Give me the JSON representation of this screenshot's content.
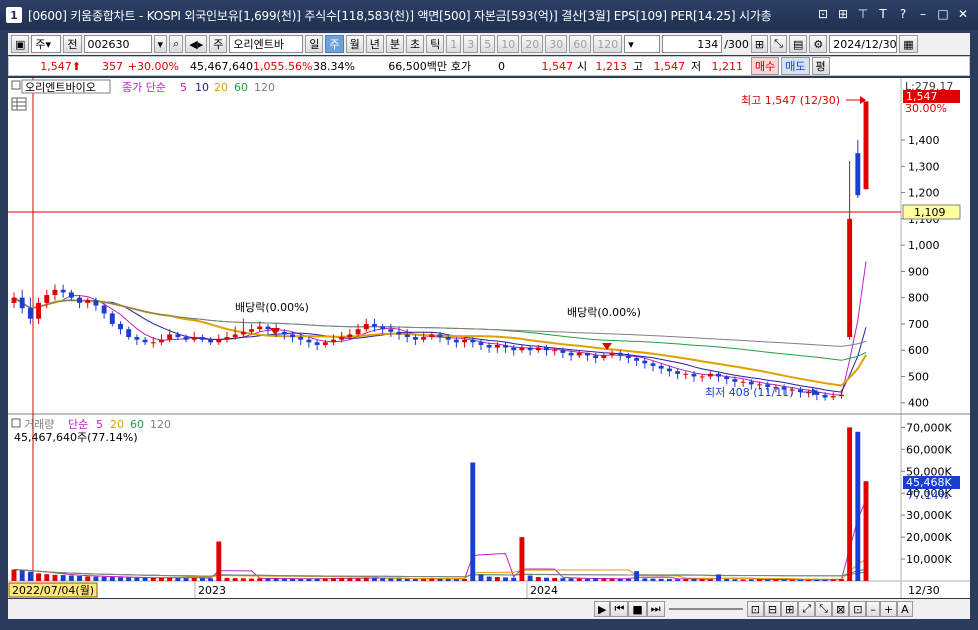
{
  "window": {
    "number": "1",
    "title": "[0600] 키움종합차트 - KOSPI 외국인보유[1,699(천)] 주식수[118,583(천)] 액면[500] 자본금[593(억)] 결산[3월] EPS[109] PER[14.25] 시가총"
  },
  "toolbar": {
    "period_select": "주",
    "prev_label": "전",
    "code": "002630",
    "stock_name": "오리엔트바",
    "periods": [
      "일",
      "주",
      "월",
      "년",
      "분",
      "초",
      "틱"
    ],
    "selected_period": "주",
    "intervals": [
      "1",
      "3",
      "5",
      "10",
      "20",
      "30",
      "60",
      "120"
    ],
    "count": "134",
    "count_total": "/300",
    "date": "2024/12/30"
  },
  "info": {
    "price": "1,547",
    "change": "357",
    "change_pct": "+30.00%",
    "volume": "45,467,640",
    "volume_ratio": "1,055.56%",
    "turnover": "38.34%",
    "amount": "66,500백만",
    "quote_label": "호가",
    "quote_value": "0",
    "quote_price": "1,547",
    "open_label": "시",
    "open": "1,213",
    "high_label": "고",
    "high": "1,547",
    "low_label": "저",
    "low": "1,211",
    "buy_btn": "매수",
    "sell_btn": "매도",
    "eval_btn": "평"
  },
  "price_panel": {
    "name": "오리엔트바이오",
    "legend_main": "종가 단순",
    "ma": [
      "5",
      "10",
      "20",
      "60",
      "120"
    ],
    "high_annotation": "최고 1,547 (12/30)",
    "low_annotation": "최저 408 (11/11)",
    "dividend1": "배당락(0.00%)",
    "dividend2": "배당락(0.00%)",
    "current_price_tag": "1,547",
    "line_tag": "1,109",
    "axis_top_text": "L:279.17",
    "axis_pct": "30.00%",
    "y_ticks": [
      "1,400",
      "1,300",
      "1,200",
      "1,100",
      "1,000",
      "900",
      "800",
      "700",
      "600",
      "500",
      "400"
    ]
  },
  "volume_panel": {
    "legend_name": "거래량",
    "legend_main": "단순",
    "ma": [
      "5",
      "20",
      "60",
      "120"
    ],
    "value_text": "45,467,640주(77.14%)",
    "tag_value": "45,468K",
    "tag_pct": "77.14%",
    "y_ticks": [
      "70,000K",
      "60,000K",
      "50,000K",
      "40,000K",
      "30,000K",
      "20,000K",
      "10,000K"
    ]
  },
  "x_axis": {
    "selected_date": "2022/07/04(월)",
    "labels": [
      "2023",
      "2024"
    ],
    "right_label": "12/30"
  },
  "colors": {
    "up": "#e00000",
    "down": "#1a3fd0",
    "ma5": "#c020c0",
    "ma10": "#2020a0",
    "ma20": "#e0a000",
    "ma60": "#20a040",
    "ma120": "#808080"
  },
  "chart_data": {
    "type": "candlestick",
    "interval": "weekly",
    "start_date": "2022/07/04",
    "end_date": "2024/12/30",
    "ylim": [
      380,
      1560
    ],
    "high": {
      "value": 1547,
      "date": "12/30"
    },
    "low": {
      "value": 408,
      "date": "11/11"
    },
    "last": {
      "open": 1213,
      "high": 1547,
      "low": 1211,
      "close": 1547,
      "volume": 45467640
    },
    "closes": [
      800,
      760,
      720,
      780,
      810,
      830,
      820,
      800,
      780,
      790,
      770,
      740,
      700,
      680,
      650,
      640,
      630,
      630,
      640,
      660,
      650,
      640,
      650,
      640,
      630,
      640,
      650,
      660,
      670,
      680,
      690,
      680,
      670,
      660,
      650,
      640,
      630,
      620,
      630,
      640,
      650,
      660,
      680,
      700,
      690,
      680,
      670,
      660,
      650,
      640,
      650,
      660,
      650,
      640,
      630,
      640,
      630,
      620,
      610,
      620,
      610,
      600,
      610,
      600,
      610,
      600,
      600,
      590,
      580,
      590,
      580,
      570,
      580,
      590,
      580,
      570,
      560,
      550,
      540,
      530,
      520,
      510,
      510,
      500,
      500,
      510,
      500,
      490,
      480,
      480,
      470,
      470,
      460,
      460,
      450,
      450,
      440,
      440,
      430,
      420,
      425,
      430,
      1100,
      1190,
      1547
    ],
    "opens": [
      780,
      800,
      760,
      720,
      780,
      810,
      830,
      820,
      800,
      780,
      790,
      770,
      740,
      700,
      680,
      650,
      640,
      630,
      630,
      640,
      660,
      650,
      640,
      650,
      640,
      630,
      640,
      650,
      660,
      670,
      680,
      690,
      680,
      670,
      660,
      650,
      640,
      630,
      620,
      630,
      640,
      650,
      660,
      680,
      700,
      690,
      680,
      670,
      660,
      650,
      640,
      650,
      660,
      650,
      640,
      630,
      640,
      630,
      620,
      610,
      620,
      610,
      600,
      610,
      600,
      610,
      600,
      600,
      590,
      580,
      590,
      580,
      570,
      580,
      590,
      580,
      570,
      560,
      550,
      540,
      530,
      520,
      510,
      510,
      500,
      500,
      510,
      500,
      490,
      480,
      480,
      470,
      470,
      460,
      460,
      450,
      450,
      440,
      440,
      430,
      420,
      425,
      650,
      1350,
      1213
    ],
    "highs": [
      820,
      830,
      800,
      800,
      830,
      850,
      850,
      830,
      810,
      800,
      800,
      780,
      750,
      710,
      690,
      660,
      650,
      650,
      660,
      680,
      670,
      660,
      670,
      660,
      650,
      660,
      670,
      690,
      720,
      700,
      710,
      700,
      700,
      680,
      670,
      660,
      650,
      640,
      640,
      660,
      670,
      680,
      700,
      720,
      720,
      700,
      700,
      690,
      680,
      660,
      670,
      670,
      670,
      660,
      650,
      650,
      650,
      640,
      630,
      630,
      630,
      620,
      620,
      620,
      620,
      620,
      610,
      610,
      600,
      600,
      590,
      590,
      590,
      600,
      600,
      590,
      580,
      570,
      560,
      550,
      540,
      530,
      520,
      520,
      510,
      520,
      515,
      505,
      500,
      490,
      490,
      480,
      480,
      470,
      470,
      460,
      460,
      450,
      450,
      440,
      440,
      450,
      1320,
      1400,
      1547
    ],
    "lows": [
      760,
      740,
      700,
      700,
      760,
      790,
      800,
      790,
      760,
      760,
      750,
      720,
      690,
      660,
      640,
      620,
      620,
      610,
      620,
      630,
      640,
      630,
      630,
      630,
      620,
      620,
      630,
      640,
      650,
      660,
      670,
      660,
      650,
      640,
      630,
      620,
      610,
      600,
      610,
      620,
      630,
      640,
      650,
      670,
      670,
      660,
      650,
      640,
      630,
      620,
      630,
      640,
      630,
      620,
      610,
      610,
      610,
      600,
      590,
      590,
      590,
      580,
      590,
      580,
      590,
      580,
      580,
      570,
      560,
      570,
      560,
      550,
      560,
      570,
      560,
      550,
      540,
      530,
      520,
      510,
      500,
      490,
      490,
      480,
      480,
      490,
      480,
      470,
      460,
      460,
      450,
      450,
      440,
      440,
      430,
      430,
      420,
      420,
      410,
      408,
      410,
      415,
      640,
      1180,
      1211
    ],
    "volumes_k": [
      5200,
      4800,
      4200,
      3500,
      3100,
      2800,
      2700,
      2500,
      2300,
      2100,
      2000,
      1900,
      1800,
      1700,
      1600,
      1500,
      1400,
      1400,
      1500,
      1600,
      1400,
      1300,
      1400,
      1300,
      1200,
      18000,
      1400,
      1300,
      1200,
      1100,
      1200,
      1100,
      1000,
      1100,
      1000,
      900,
      1000,
      1100,
      1200,
      1300,
      1400,
      1300,
      1200,
      1500,
      1400,
      1300,
      1200,
      1100,
      1000,
      900,
      1000,
      1100,
      1000,
      900,
      800,
      900,
      54000,
      3000,
      2000,
      1800,
      1600,
      1500,
      20000,
      2500,
      1800,
      1500,
      1400,
      1300,
      1200,
      1100,
      1000,
      1200,
      1100,
      1000,
      900,
      1000,
      4500,
      1200,
      1100,
      1000,
      900,
      800,
      900,
      1000,
      800,
      700,
      3000,
      900,
      800,
      700,
      800,
      700,
      600,
      700,
      600,
      500,
      600,
      500,
      600,
      700,
      800,
      900,
      70000,
      68000,
      45468
    ]
  }
}
